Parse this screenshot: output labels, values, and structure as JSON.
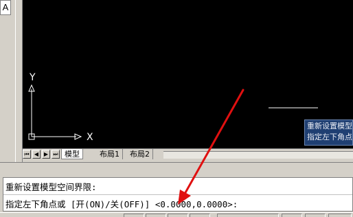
{
  "corner_button": {
    "label": "A"
  },
  "canvas": {
    "background": "#000000",
    "ucs_y_label": "Y",
    "ucs_x_label": "X"
  },
  "tabs": {
    "nav": [
      "⏮",
      "◀",
      "▶",
      "⏭"
    ],
    "items": [
      {
        "label": "模型",
        "active": true
      },
      {
        "label": "布局1",
        "active": false
      },
      {
        "label": "布局2",
        "active": false
      }
    ]
  },
  "tooltip": {
    "line1": "重新设置模型",
    "line2": "指定左下角点"
  },
  "command": {
    "line1": "重新设置模型空间界限:",
    "line2": "指定左下角点或 [开(ON)/关(OFF)] <0.0000,0.0000>:"
  },
  "annotation": {
    "arrow_color": "#e01010"
  }
}
